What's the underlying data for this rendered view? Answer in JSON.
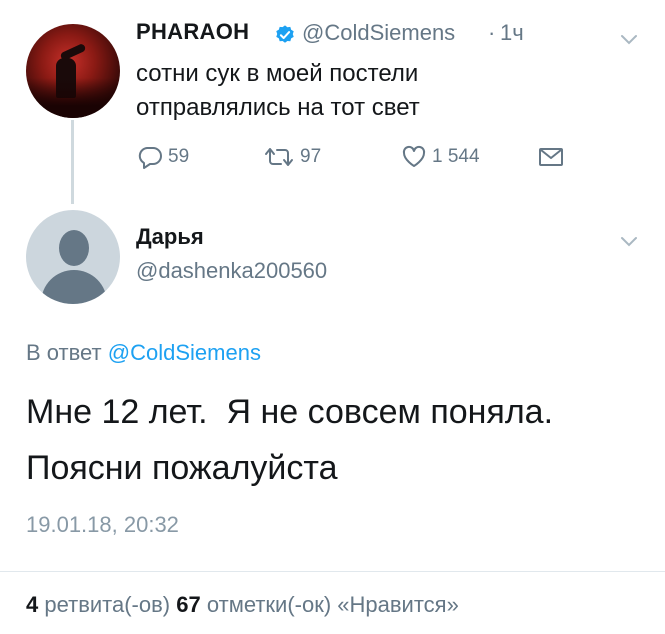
{
  "parent_tweet": {
    "name": "PHARAOH",
    "handle": "@ColdSiemens",
    "separator": "·",
    "time": "1ч",
    "text_line1": "сотни сук в моей постели",
    "text_line2": "отправлялись на тот свет",
    "replies": "59",
    "retweets": "97",
    "likes": "1 544"
  },
  "reply_tweet": {
    "name": "Дарья",
    "handle": "@dashenka200560",
    "replying_prefix": "В ответ",
    "replying_to": "@ColdSiemens",
    "text_line1": "Мне 12 лет.  Я не совсем поняла.",
    "text_line2": "Поясни пожалуйста",
    "date": "19.01.18, 20:32"
  },
  "stats": {
    "retweet_count": "4",
    "retweet_label": "ретвита(-ов)",
    "like_count": "67",
    "like_label": "отметки(-ок) «Нравится»"
  },
  "colors": {
    "accent": "#1da1f2",
    "secondary_text": "#657786",
    "primary_text": "#14171a"
  }
}
